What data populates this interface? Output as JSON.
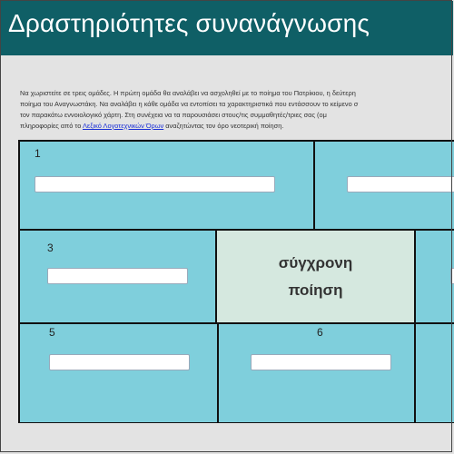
{
  "header": {
    "title": "Δραστηριότητες συνανάγνωσης",
    "bg": "#0f5f66"
  },
  "intro": {
    "line1": "Να χωριστείτε σε τρεις ομάδες. Η πρώτη ομάδα θα αναλάβει να ασχοληθεί με το ποίημα του Πατρίκιου, η δεύτερη",
    "line2": "ποίημα του Αναγνωστάκη. Να αναλάβει η κάθε ομάδα να εντοπίσει τα χαρακτηριστικά που εντάσσουν το κείμενο σ",
    "line3": "τον παρακάτω εννοιολογικό χάρτη. Στη συνέχεια να τα παρουσιάσει στους/τις συμμαθητές/τριες σας (ομ",
    "line4_before": "πληροφορίες από το ",
    "link": "Λεξικό Λογοτεχνικών Όρων",
    "line4_after": " αναζητώντας τον όρο νεοτερική ποίηση."
  },
  "concept_map": {
    "center_line1": "σύγχρονη",
    "center_line2": "ποίηση",
    "cells": [
      {
        "number": "1",
        "value": ""
      },
      {
        "number": "",
        "value": ""
      },
      {
        "number": "3",
        "value": ""
      },
      {
        "number": "5",
        "value": ""
      },
      {
        "number": "6",
        "value": ""
      }
    ],
    "cell_color": "#7fcfdc",
    "center_color": "#d5e8df"
  }
}
